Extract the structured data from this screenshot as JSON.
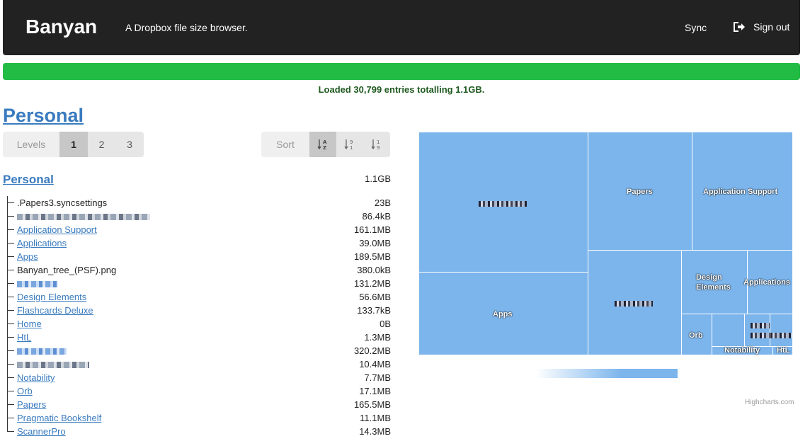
{
  "navbar": {
    "brand": "Banyan",
    "tagline": "A Dropbox file size browser.",
    "sync": "Sync",
    "signout": "Sign out"
  },
  "progress": {
    "fraction": 1.0,
    "status": "Loaded 30,799 entries totalling 1.1GB."
  },
  "root_title": "Personal",
  "levels": {
    "label": "Levels",
    "options": [
      "1",
      "2",
      "3"
    ],
    "selected": "1"
  },
  "sort": {
    "label": "Sort",
    "options": [
      "sort-alpha-icon",
      "sort-size-asc-icon",
      "sort-size-desc-icon"
    ],
    "selected": "sort-alpha-icon"
  },
  "tree": {
    "root": {
      "name": "Personal",
      "size": "1.1GB"
    },
    "items": [
      {
        "name": ".Papers3.syncsettings",
        "size": "23B",
        "type": "file"
      },
      {
        "name": "",
        "size": "86.4kB",
        "type": "redacted"
      },
      {
        "name": "Application Support",
        "size": "161.1MB",
        "type": "folder"
      },
      {
        "name": "Applications",
        "size": "39.0MB",
        "type": "folder"
      },
      {
        "name": "Apps",
        "size": "189.5MB",
        "type": "folder"
      },
      {
        "name": "Banyan_tree_(PSF).png",
        "size": "380.0kB",
        "type": "file"
      },
      {
        "name": "",
        "size": "131.2MB",
        "type": "redacted-link"
      },
      {
        "name": "Design Elements",
        "size": "56.6MB",
        "type": "folder"
      },
      {
        "name": "Flashcards Deluxe",
        "size": "133.7kB",
        "type": "folder"
      },
      {
        "name": "Home",
        "size": "0B",
        "type": "folder"
      },
      {
        "name": "HtL",
        "size": "1.3MB",
        "type": "folder"
      },
      {
        "name": "",
        "size": "320.2MB",
        "type": "redacted-link"
      },
      {
        "name": "",
        "size": "10.4MB",
        "type": "redacted"
      },
      {
        "name": "Notability",
        "size": "7.7MB",
        "type": "folder"
      },
      {
        "name": "Orb",
        "size": "17.1MB",
        "type": "folder"
      },
      {
        "name": "Papers",
        "size": "165.5MB",
        "type": "folder"
      },
      {
        "name": "Pragmatic Bookshelf",
        "size": "11.1MB",
        "type": "folder"
      },
      {
        "name": "ScannerPro",
        "size": "14.3MB",
        "type": "folder"
      }
    ]
  },
  "treemap": {
    "color": "#7cb5ec",
    "labels": {
      "papers": "Papers",
      "app_support": "Application Support",
      "apps": "Apps",
      "design": "Design",
      "elements": "Elements",
      "applications": "Applications",
      "orb": "Orb",
      "notability": "Notability",
      "htl": "HtL"
    }
  },
  "credits": "Highcharts.com",
  "colors": {
    "nav_bg": "#222222",
    "progress": "#22bb44",
    "link": "#3a7bbf",
    "treemap": "#7cb5ec"
  }
}
